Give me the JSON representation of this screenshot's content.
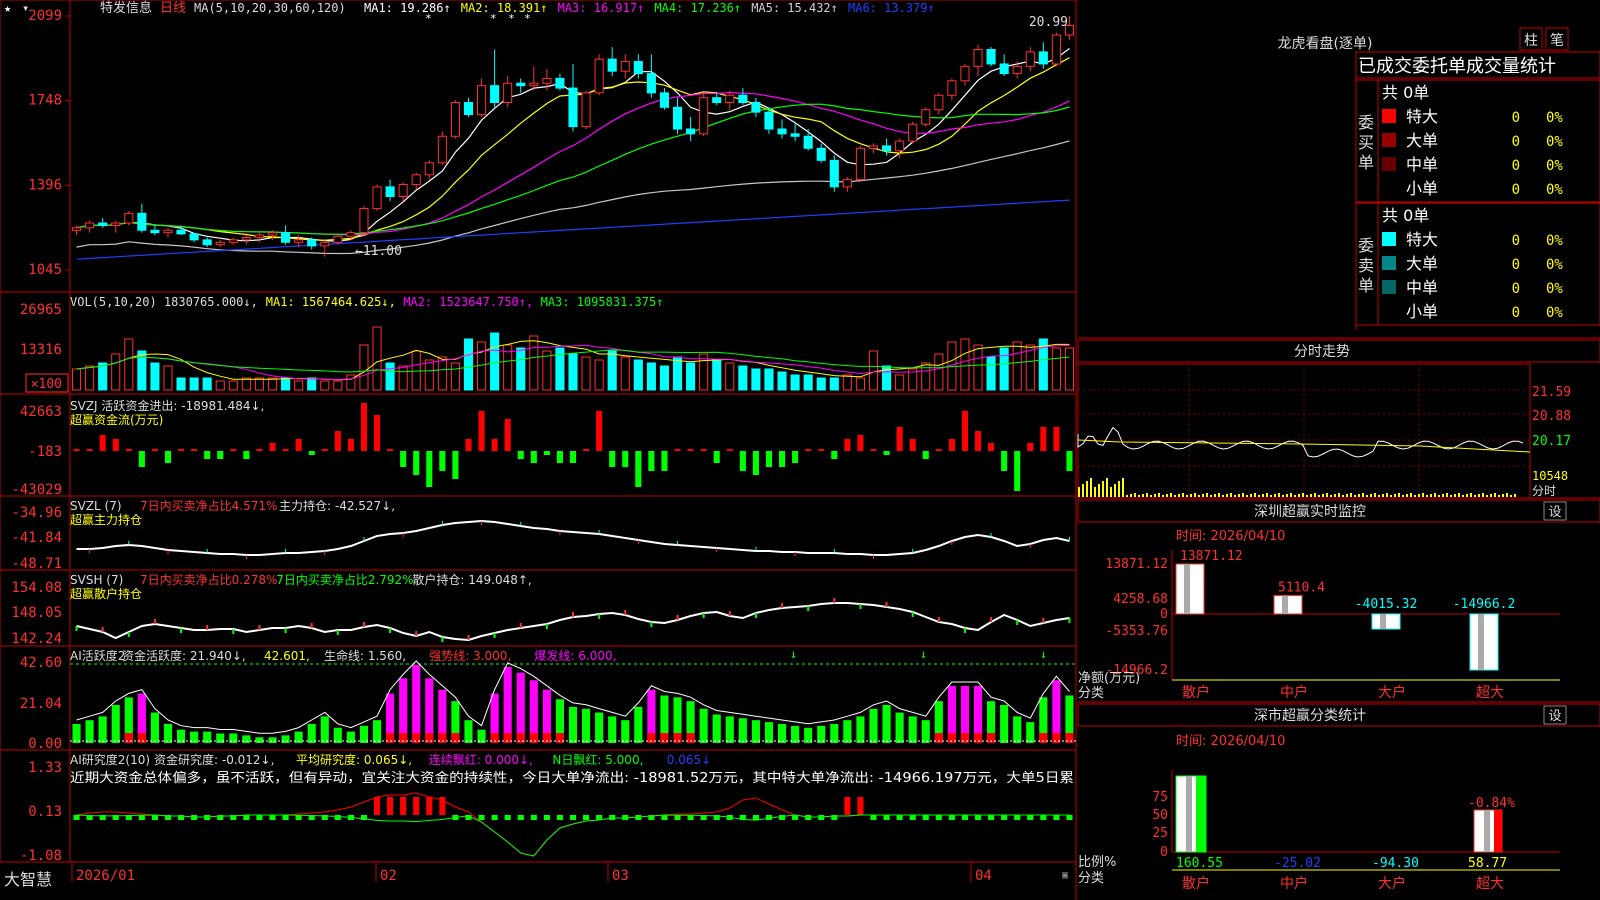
{
  "header": {
    "stock_name": "特发信息",
    "period": "日线",
    "ma_label": "MA(5,10,20,30,60,120)",
    "ma_values": [
      {
        "label": "MA1: 19.286↑",
        "color": "#ffffff"
      },
      {
        "label": "MA2: 18.391↑",
        "color": "#ffff00"
      },
      {
        "label": "MA3: 16.917↑",
        "color": "#ff00ff"
      },
      {
        "label": "MA4: 17.236↑",
        "color": "#00ff00"
      },
      {
        "label": "MA5: 15.432↑",
        "color": "#d0d0d0"
      },
      {
        "label": "MA6: 13.379↑",
        "color": "#2040ff"
      }
    ],
    "high_label": "20.99",
    "low_label": "←11.00",
    "price_axis": [
      "2099",
      "1748",
      "1396",
      "1045"
    ]
  },
  "vol_panel": {
    "header": [
      {
        "text": "VOL(5,10,20) 1830765.000↓,",
        "color": "#dddddd"
      },
      {
        "text": "MA1: 1567464.625↓,",
        "color": "#ffff00"
      },
      {
        "text": "MA2: 1523647.750↑,",
        "color": "#ff00ff"
      },
      {
        "text": "MA3: 1095831.375↑",
        "color": "#00ff00"
      }
    ],
    "axis": [
      "26965",
      "13316",
      "×100"
    ]
  },
  "svzj_panel": {
    "header": "SVZJ  活跃资金进出: -18981.484↓,",
    "subtitle": "超赢资金流(万元)",
    "axis": [
      "42663",
      "-183",
      "-43029"
    ]
  },
  "svzl_panel": {
    "header": [
      {
        "text": "SVZL (7)",
        "color": "#dddddd"
      },
      {
        "text": "7日内买卖净占比4.571%",
        "color": "#ff3030"
      },
      {
        "text": "主力持仓: -42.527↓,",
        "color": "#dddddd"
      }
    ],
    "subtitle": "超赢主力持仓",
    "axis": [
      "-34.96",
      "-41.84",
      "-48.71"
    ]
  },
  "svsh_panel": {
    "header": [
      {
        "text": "SVSH (7)",
        "color": "#dddddd"
      },
      {
        "text": "7日内买卖净占比0.278%",
        "color": "#ff3030"
      },
      {
        "text": "7日内买卖净占比2.792%",
        "color": "#00ff00"
      },
      {
        "text": "散户持仓: 149.048↑,",
        "color": "#dddddd"
      }
    ],
    "subtitle": "超赢散户持仓",
    "axis": [
      "154.08",
      "148.05",
      "142.24"
    ]
  },
  "ai_active_panel": {
    "header": [
      {
        "text": "AI活跃度2",
        "color": "#dddddd"
      },
      {
        "text": "资金活跃度: 21.940↓,",
        "color": "#dddddd"
      },
      {
        "text": "42.601,",
        "color": "#ffff00"
      },
      {
        "text": "生命线: 1.560,",
        "color": "#dddddd"
      },
      {
        "text": "强势线: 3.000,",
        "color": "#ff3030"
      },
      {
        "text": "爆发线: 6.000,",
        "color": "#ff00ff"
      }
    ],
    "axis": [
      "42.60",
      "21.04",
      "0.00"
    ]
  },
  "ai_research_panel": {
    "header": [
      {
        "text": "AI研究度2(10)",
        "color": "#dddddd"
      },
      {
        "text": "资金研究度: -0.012↓,",
        "color": "#dddddd"
      },
      {
        "text": "平均研究度: 0.065↓,",
        "color": "#ffff00"
      },
      {
        "text": "连续飘红: 0.000↓,",
        "color": "#ff00ff"
      },
      {
        "text": "N日飘红: 5.000,",
        "color": "#00ff00"
      },
      {
        "text": "0.065↓",
        "color": "#2040ff"
      }
    ],
    "commentary": "近期大资金总体偏多，虽不活跃，但有异动，宜关注大资金的持续性，今日大单净流出: -18981.52万元，其中特大单净流出: -14966.197万元，大单5日累",
    "axis": [
      "1.33",
      "0.13",
      "-1.08"
    ]
  },
  "time_axis": {
    "brand": "大智慧",
    "labels": [
      "2026/01",
      "02",
      "03",
      "04"
    ]
  },
  "right_panel": {
    "lhb": {
      "title": "龙虎看盘(逐单)",
      "tab_zhu": "柱",
      "tab_bi": "笔",
      "subtitle": "已成交委托单成交量统计",
      "buy": {
        "side_label": "委买单",
        "total": "共 0单",
        "rows": [
          {
            "name": "特大",
            "count": "0",
            "pct": "0%",
            "color": "#ff0000"
          },
          {
            "name": "大单",
            "count": "0",
            "pct": "0%",
            "color": "#990000"
          },
          {
            "name": "中单",
            "count": "0",
            "pct": "0%",
            "color": "#660000"
          },
          {
            "name": "小单",
            "count": "0",
            "pct": "0%",
            "color": ""
          }
        ]
      },
      "sell": {
        "side_label": "委卖单",
        "total": "共 0单",
        "rows": [
          {
            "name": "特大",
            "count": "0",
            "pct": "0%",
            "color": "#00ffff"
          },
          {
            "name": "大单",
            "count": "0",
            "pct": "0%",
            "color": "#008888"
          },
          {
            "name": "中单",
            "count": "0",
            "pct": "0%",
            "color": "#006666"
          },
          {
            "name": "小单",
            "count": "0",
            "pct": "0%",
            "color": ""
          }
        ]
      }
    },
    "intraday": {
      "title": "分时走势",
      "axis": [
        "21.59",
        "20.88",
        "20.17",
        "10548",
        "分时"
      ]
    },
    "sz_monitor": {
      "title": "深圳超赢实时监控",
      "set_label": "设",
      "time_label": "时间: 2026/04/10",
      "yaxis": [
        "13871.12",
        "4258.68",
        "0",
        "-5353.76",
        "-14966.2"
      ],
      "ylabel": "净额(万元)",
      "xlabel_title": "分类",
      "categories": [
        "散户",
        "中户",
        "大户",
        "超大"
      ],
      "values": [
        13871.12,
        5110.4,
        -4015.32,
        -14966.2
      ],
      "value_labels": [
        "13871.12",
        "5110.4",
        "-4015.32",
        "-14966.2"
      ]
    },
    "sz_classify": {
      "title": "深市超赢分类统计",
      "set_label": "设",
      "time_label": "时间: 2026/04/10",
      "yaxis": [
        "75",
        "50",
        "25",
        "0"
      ],
      "ylabel": "比例%",
      "xlabel_title": "分类",
      "categories": [
        "散户",
        "中户",
        "大户",
        "超大"
      ],
      "value_labels": [
        "160.55",
        "-25.02",
        "-94.30",
        "58.77"
      ],
      "value_colors": [
        "#00ff00",
        "#2040ff",
        "#00ffff",
        "#ffff00"
      ],
      "annotation": "-0.84%"
    }
  },
  "chart_data": {
    "type": "candlestick",
    "x_range": [
      "2026/01",
      "2026/04/10"
    ],
    "price_range": [
      10.45,
      20.99
    ],
    "ma_periods": [
      5,
      10,
      20,
      30,
      60,
      120
    ],
    "bars": [
      [
        12.1,
        12.3,
        11.9,
        12.2
      ],
      [
        12.2,
        12.5,
        12.0,
        12.4
      ],
      [
        12.4,
        12.6,
        12.2,
        12.3
      ],
      [
        12.3,
        12.5,
        12.0,
        12.4
      ],
      [
        12.4,
        12.9,
        12.3,
        12.8
      ],
      [
        12.8,
        13.2,
        12.0,
        12.1
      ],
      [
        12.1,
        12.3,
        11.9,
        12.0
      ],
      [
        12.0,
        12.2,
        11.8,
        12.1
      ],
      [
        12.1,
        12.3,
        11.9,
        11.95
      ],
      [
        11.95,
        12.0,
        11.6,
        11.7
      ],
      [
        11.7,
        11.8,
        11.4,
        11.5
      ],
      [
        11.5,
        11.7,
        11.4,
        11.6
      ],
      [
        11.6,
        11.8,
        11.5,
        11.7
      ],
      [
        11.7,
        11.9,
        11.5,
        11.8
      ],
      [
        11.8,
        12.0,
        11.6,
        11.9
      ],
      [
        11.9,
        12.1,
        11.7,
        12.0
      ],
      [
        12.0,
        12.3,
        11.5,
        11.6
      ],
      [
        11.6,
        11.9,
        11.4,
        11.7
      ],
      [
        11.7,
        11.8,
        11.3,
        11.45
      ],
      [
        11.45,
        11.7,
        11.0,
        11.6
      ],
      [
        11.6,
        11.9,
        11.5,
        11.85
      ],
      [
        11.85,
        12.1,
        11.7,
        12.0
      ],
      [
        12.0,
        13.1,
        12.0,
        13.0
      ],
      [
        13.0,
        14.0,
        12.9,
        13.9
      ],
      [
        13.9,
        14.2,
        13.3,
        13.5
      ],
      [
        13.5,
        14.1,
        13.3,
        14.0
      ],
      [
        14.0,
        14.5,
        13.8,
        14.4
      ],
      [
        14.4,
        15.0,
        14.2,
        14.9
      ],
      [
        14.9,
        16.2,
        14.8,
        16.0
      ],
      [
        16.0,
        17.5,
        15.9,
        17.4
      ],
      [
        17.4,
        17.6,
        16.8,
        16.9
      ],
      [
        16.9,
        18.4,
        16.8,
        18.1
      ],
      [
        18.1,
        19.6,
        17.2,
        17.4
      ],
      [
        17.4,
        18.5,
        17.2,
        18.2
      ],
      [
        18.2,
        18.4,
        17.8,
        18.1
      ],
      [
        18.1,
        18.9,
        17.9,
        18.2
      ],
      [
        18.2,
        18.8,
        17.9,
        18.4
      ],
      [
        18.4,
        18.6,
        17.9,
        18.0
      ],
      [
        18.0,
        19.0,
        16.2,
        16.4
      ],
      [
        16.4,
        17.9,
        16.3,
        17.8
      ],
      [
        17.8,
        19.4,
        17.7,
        19.2
      ],
      [
        19.2,
        19.7,
        18.5,
        18.7
      ],
      [
        18.7,
        19.4,
        18.4,
        19.1
      ],
      [
        19.1,
        19.4,
        18.4,
        18.6
      ],
      [
        18.6,
        19.4,
        17.6,
        17.8
      ],
      [
        17.8,
        18.0,
        17.1,
        17.2
      ],
      [
        17.2,
        17.6,
        16.1,
        16.3
      ],
      [
        16.3,
        16.8,
        15.8,
        16.1
      ],
      [
        16.1,
        17.8,
        16.0,
        17.6
      ],
      [
        17.6,
        17.8,
        17.3,
        17.4
      ],
      [
        17.4,
        17.9,
        17.1,
        17.7
      ],
      [
        17.7,
        18.0,
        17.3,
        17.4
      ],
      [
        17.4,
        17.6,
        16.8,
        17.0
      ],
      [
        17.0,
        17.2,
        16.1,
        16.3
      ],
      [
        16.3,
        16.7,
        15.9,
        16.1
      ],
      [
        16.1,
        16.6,
        15.8,
        16.0
      ],
      [
        16.0,
        16.3,
        15.4,
        15.5
      ],
      [
        15.5,
        15.7,
        14.9,
        15.0
      ],
      [
        15.0,
        15.2,
        13.7,
        13.9
      ],
      [
        13.9,
        14.3,
        13.7,
        14.2
      ],
      [
        14.2,
        15.6,
        14.1,
        15.5
      ],
      [
        15.5,
        15.7,
        15.3,
        15.6
      ],
      [
        15.6,
        15.9,
        15.2,
        15.4
      ],
      [
        15.4,
        15.9,
        15.1,
        15.8
      ],
      [
        15.8,
        16.6,
        15.7,
        16.5
      ],
      [
        16.5,
        17.2,
        16.4,
        17.1
      ],
      [
        17.1,
        17.8,
        16.9,
        17.7
      ],
      [
        17.7,
        18.4,
        17.5,
        18.3
      ],
      [
        18.3,
        19.0,
        18.1,
        18.9
      ],
      [
        18.9,
        19.8,
        18.5,
        19.6
      ],
      [
        19.6,
        19.7,
        18.9,
        19.0
      ],
      [
        19.0,
        19.4,
        18.5,
        18.6
      ],
      [
        18.6,
        19.1,
        18.4,
        18.9
      ],
      [
        18.9,
        19.7,
        18.7,
        19.5
      ],
      [
        19.5,
        19.9,
        18.8,
        19.0
      ],
      [
        19.0,
        20.3,
        18.9,
        20.2
      ],
      [
        20.2,
        20.99,
        20.0,
        20.6
      ]
    ],
    "vol_range": [
      0,
      26965
    ],
    "fund_flow_range": [
      -43029,
      42663
    ],
    "main_hold_range": [
      -48.71,
      -34.96
    ],
    "retail_hold_range": [
      142.24,
      154.08
    ],
    "active_range": [
      0,
      42.6
    ],
    "research_range": [
      -1.08,
      1.33
    ]
  }
}
